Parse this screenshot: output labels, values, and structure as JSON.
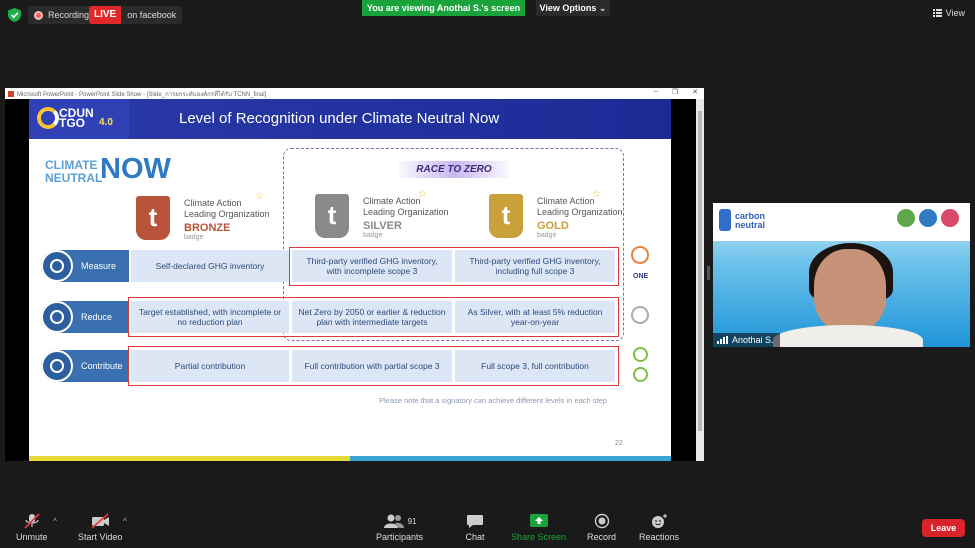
{
  "top_bar": {
    "recording_label": "Recording",
    "live_badge": "LIVE",
    "live_platform": "on facebook",
    "viewing_banner": "You are viewing Anothai S.'s screen",
    "view_options": "View Options",
    "view_button": "View"
  },
  "ppt_window": {
    "title": "Microsoft PowerPoint - PowerPoint Slide Show - [Slide_การยกระดับองค์กรที่ได้รับ TCNN_final]"
  },
  "slide": {
    "title": "Level of Recognition under Climate Neutral Now",
    "logo_text_1": "CDUN",
    "logo_text_2": "TGO",
    "logo_version": "4.0",
    "cn_small_1": "CLIMATE",
    "cn_small_2": "NEUTRAL",
    "cn_now": "NOW",
    "race_to_zero": "RACE TO ZERO",
    "badges": [
      {
        "caption_1": "Climate Action",
        "caption_2": "Leading Organization",
        "level": "BRONZE",
        "sub": "badge",
        "color": "#b9533a"
      },
      {
        "caption_1": "Climate Action",
        "caption_2": "Leading Organization",
        "level": "SILVER",
        "sub": "badge",
        "color": "#8a8a8a"
      },
      {
        "caption_1": "Climate Action",
        "caption_2": "Leading Organization",
        "level": "GOLD",
        "sub": "badge",
        "color": "#c9a03a"
      }
    ],
    "rows": [
      {
        "label": "Measure",
        "cells": [
          "Self-declared GHG inventory",
          "Third-party verified GHG inventory, with incomplete scope 3",
          "Third-party verified GHG inventory, including full scope 3"
        ]
      },
      {
        "label": "Reduce",
        "cells": [
          "Target established, with incomplete or no reduction plan",
          "Net Zero by 2050 or earlier & reduction plan with intermediate targets",
          "As Silver, with at least 5% reduction year-on-year"
        ]
      },
      {
        "label": "Contribute",
        "cells": [
          "Partial contribution",
          "Full contribution with partial scope 3",
          "Full scope 3, full contribution"
        ]
      }
    ],
    "side_logo_one": "ONE",
    "note": "Please note that a signatory can achieve different levels in each step",
    "page_number": "22"
  },
  "video": {
    "org_text_1": "carbon",
    "org_text_2": "neutral",
    "participant_name": "Anothai S."
  },
  "toolbar": {
    "unmute": "Unmute",
    "start_video": "Start Video",
    "participants": "Participants",
    "participant_count": "91",
    "chat": "Chat",
    "share_screen": "Share Screen",
    "record": "Record",
    "reactions": "Reactions",
    "leave": "Leave"
  },
  "colors": {
    "share_green": "#1aa33a",
    "leave_red": "#d9232b",
    "live_red": "#e02828"
  }
}
